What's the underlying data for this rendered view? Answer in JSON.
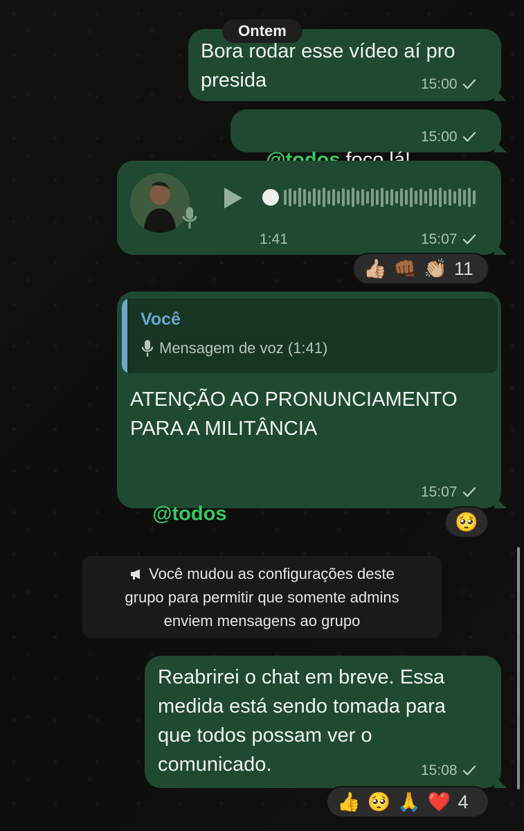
{
  "date_separator": "Ontem",
  "messages": [
    {
      "text": "Bora rodar esse vídeo aí pro\npresida",
      "time": "15:00"
    },
    {
      "mention": "@todos",
      "text": " foco lá!",
      "time": "15:00"
    },
    {
      "type": "voice",
      "duration": "1:41",
      "time": "15:07",
      "reactions": {
        "emoji": [
          "👍🏼",
          "👊🏾",
          "👏🏼"
        ],
        "count": "11"
      }
    },
    {
      "reply_to": {
        "author": "Você",
        "preview": "Mensagem de voz (1:41)"
      },
      "text": "ATENÇÃO AO PRONUNCIAMENTO\nPARA A MILITÂNCIA",
      "mention": "@todos",
      "time": "15:07",
      "reaction": "🥺"
    },
    {
      "type": "system",
      "text_lines": [
        "Você mudou as configurações deste",
        "grupo para permitir que somente admins",
        "enviem mensagens ao grupo"
      ]
    },
    {
      "text": "Reabrirei o chat em breve. Essa\nmedida está sendo tomada para\nque todos possam ver o\ncomunicado.",
      "time": "15:08",
      "reactions": {
        "emoji": [
          "👍",
          "🥺",
          "🙏",
          "❤️"
        ],
        "count": "4"
      }
    }
  ],
  "colors": {
    "bubble": "#1f4a31",
    "mention": "#36c85f",
    "quote_author": "#6aa7cf"
  },
  "icons": {
    "read_check": "check-icon",
    "play": "play-icon",
    "microphone": "microphone-icon",
    "announcement": "megaphone-icon"
  }
}
